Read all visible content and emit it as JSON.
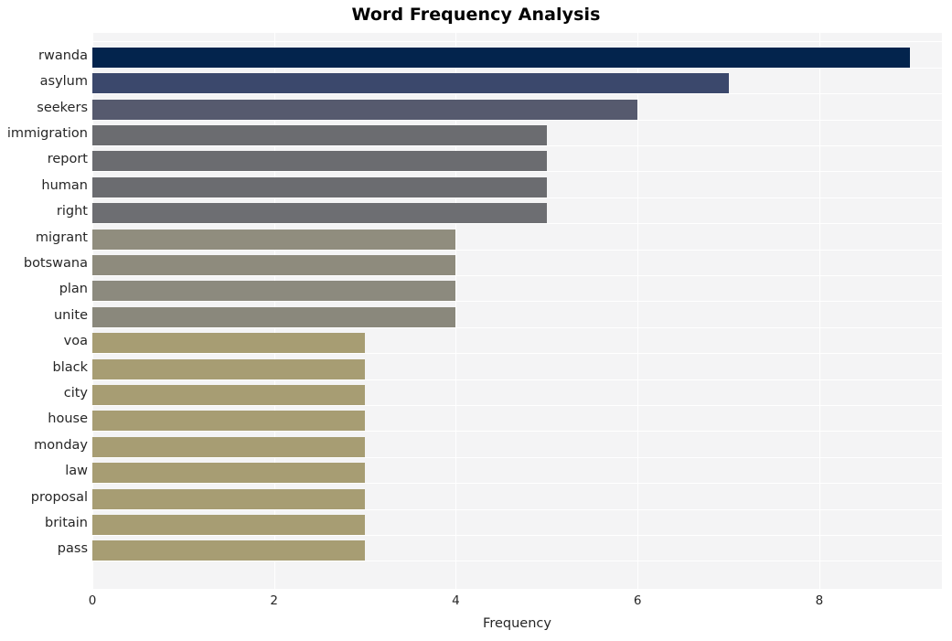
{
  "chart_data": {
    "type": "bar",
    "orientation": "horizontal",
    "title": "Word Frequency Analysis",
    "xlabel": "Frequency",
    "ylabel": "",
    "categories": [
      "rwanda",
      "asylum",
      "seekers",
      "immigration",
      "report",
      "human",
      "right",
      "migrant",
      "botswana",
      "plan",
      "unite",
      "voa",
      "black",
      "city",
      "house",
      "monday",
      "law",
      "proposal",
      "britain",
      "pass"
    ],
    "values": [
      9,
      7,
      6,
      5,
      5,
      5,
      5,
      4,
      4,
      4,
      4,
      3,
      3,
      3,
      3,
      3,
      3,
      3,
      3,
      3
    ],
    "bar_colors": [
      "#03244d",
      "#3b486c",
      "#565a6e",
      "#6b6c70",
      "#6b6c70",
      "#6b6c70",
      "#6d6e72",
      "#908d7e",
      "#8e8b7d",
      "#8c8a7e",
      "#8a887c",
      "#a79d73",
      "#a79d73",
      "#a79d73",
      "#a79d73",
      "#a79d73",
      "#a79d73",
      "#a79d73",
      "#a79d73",
      "#a79d73"
    ],
    "xlim": [
      0,
      9.35
    ],
    "xticks": [
      0,
      2,
      4,
      6,
      8
    ],
    "xtick_labels": [
      "0",
      "2",
      "4",
      "6",
      "8"
    ],
    "grid": true,
    "grid_color": "#ffffff",
    "plot_background": "#f4f4f5",
    "figure_background": "#ffffff",
    "legend": null
  }
}
